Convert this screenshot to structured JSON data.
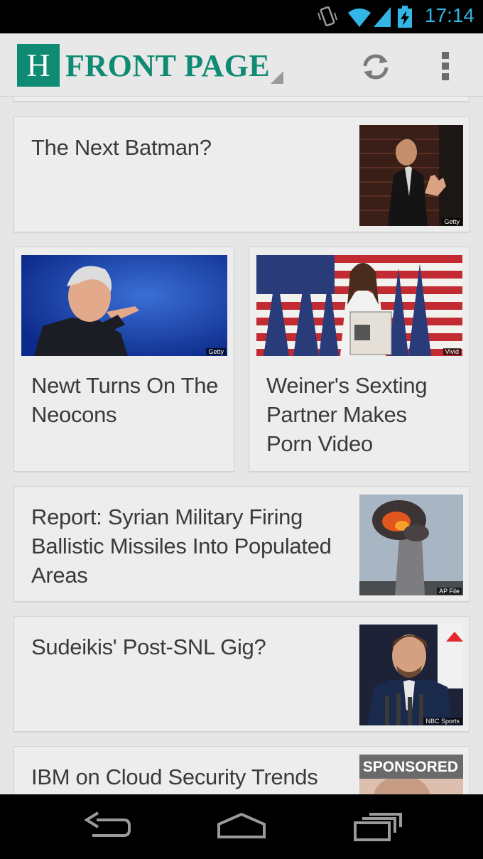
{
  "status_bar": {
    "time": "17:14"
  },
  "action_bar": {
    "logo_letter": "H",
    "title": "FRONT PAGE"
  },
  "stories": [
    {
      "headline": "The Next Batman?",
      "credit": "Getty"
    },
    {
      "headline": "Newt Turns On The Neocons",
      "credit": "Getty"
    },
    {
      "headline": "Weiner's Sexting Partner Makes Porn Video",
      "credit": "Vivid"
    },
    {
      "headline": "Report: Syrian Military Firing Ballistic Missiles Into Populated Areas",
      "credit": "AP File"
    },
    {
      "headline": "Sudeikis' Post-SNL Gig?",
      "credit": "NBC Sports"
    },
    {
      "headline": "IBM on Cloud Security Trends",
      "badge": "SPONSORED"
    }
  ],
  "colors": {
    "brand": "#0f8b73",
    "status_accent": "#33b5e5"
  }
}
